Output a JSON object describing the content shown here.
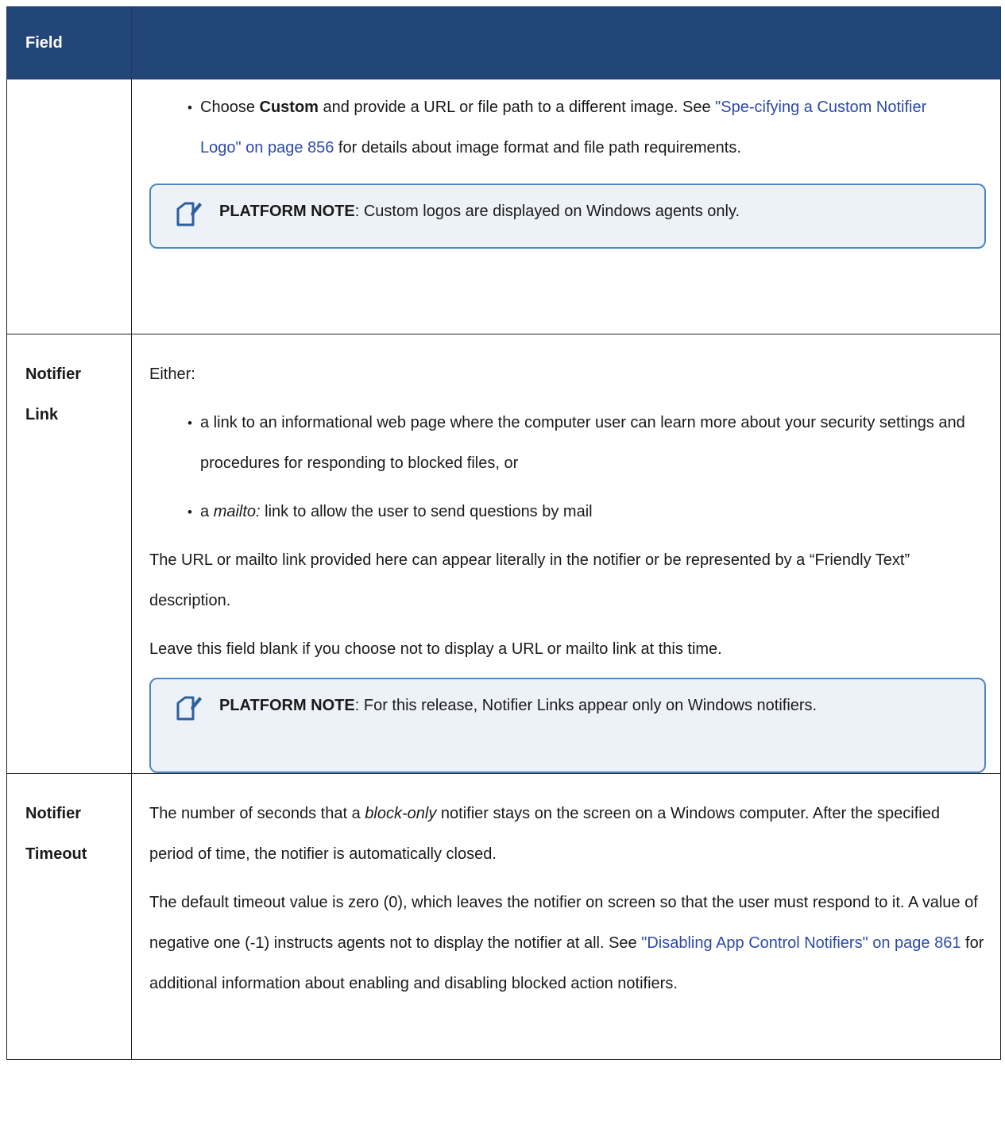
{
  "header": {
    "field_label": "Field",
    "desc_label": ""
  },
  "rows": [
    {
      "field": "",
      "bullet_intro": "Choose ",
      "bullet_bold": "Custom",
      "bullet_mid": " and provide a URL or file path to a different image. See ",
      "bullet_link": "\"Spe-cifying a Custom Notifier Logo\" on page 856",
      "bullet_end": " for details about image format and file path requirements.",
      "note": {
        "label": "PLATFORM NOTE",
        "text": ": Custom logos are displayed on Windows agents only."
      }
    },
    {
      "field_line1": "Notifier",
      "field_line2": "Link",
      "intro": "Either:",
      "bullet1": "a link to an informational web page where the computer user can learn more about your security settings and procedures for responding to blocked files, or",
      "bullet2_pre": "a ",
      "bullet2_italic": "mailto:",
      "bullet2_post": " link to allow the user to send questions by mail",
      "para1": "The URL or mailto link provided here can appear literally in the notifier or be represented by a “Friendly Text” description.",
      "para2": "Leave this field blank if you choose not to display a URL or mailto link at this time.",
      "note": {
        "label": "PLATFORM NOTE",
        "text": ": For this release, Notifier Links appear only on Windows notifiers."
      }
    },
    {
      "field_line1": "Notifier",
      "field_line2": "Timeout",
      "para1_pre": "The number of seconds that a ",
      "para1_italic": "block-only",
      "para1_post": " notifier stays on the screen on a Windows computer. After the specified period of time, the notifier is automatically closed.",
      "para2_pre": "The default timeout value is zero (0), which leaves the notifier on screen so that the user must respond to it. A value of negative one (-1) instructs agents not to display the notifier at all. See ",
      "para2_link": "\"Disabling App Control Notifiers\" on page 861",
      "para2_post": " for additional information about enabling and disabling blocked action notifiers."
    }
  ]
}
